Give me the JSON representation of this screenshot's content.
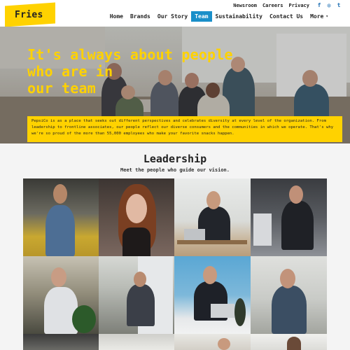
{
  "brand": {
    "logo_text": "Fries",
    "accent": "#ffd200",
    "nav_active": "#1a8fc9"
  },
  "utility_nav": [
    {
      "label": "Newsroom"
    },
    {
      "label": "Careers"
    },
    {
      "label": "Privacy"
    }
  ],
  "social": [
    {
      "icon": "facebook-icon",
      "glyph": "f"
    },
    {
      "icon": "instagram-icon",
      "glyph": "◎"
    },
    {
      "icon": "twitter-icon",
      "glyph": "t"
    }
  ],
  "main_nav": [
    {
      "label": "Home"
    },
    {
      "label": "Brands"
    },
    {
      "label": "Our Story"
    },
    {
      "label": "Team",
      "active": true
    },
    {
      "label": "Sustainability"
    },
    {
      "label": "Contact Us"
    },
    {
      "label": "More"
    }
  ],
  "hero": {
    "title_lines": [
      "It's always about people",
      "who are in",
      "our team"
    ],
    "body": "PepsiCo is as a place that seeks out different perspectives and celebrates diversity at every level of the organization. From leadership to frontline associates, our people reflect our diverse consumers and the communities in which we operate. That's why we're so proud of the more than 55,000 employees who make your favorite snacks happen."
  },
  "leadership": {
    "title": "Leadership",
    "subtitle": "Meet the people who guide our vision."
  }
}
